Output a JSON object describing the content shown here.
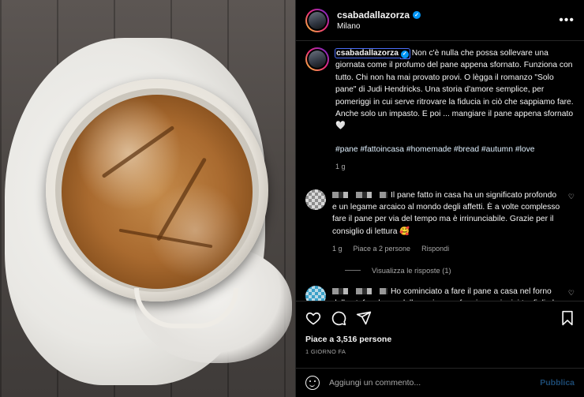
{
  "post": {
    "username": "csabadallazorza",
    "location": "Milano",
    "more_icon": "ellipsis-icon"
  },
  "caption": {
    "username": "csabadallazorza",
    "text": "Non c'è nulla che possa sollevare una giornata come il profumo del pane appena sfornato. Funziona con tutto. Chi non ha mai provato provi. O lègga il romanzo \"Solo pane\" di Judi Hendricks. Una storia d'amore semplice, per pomeriggi in cui serve ritrovare la fiducia in ciò che sappiamo fare. Anche solo un impasto. E poi ... mangiare il pane appena sfornato 🤍",
    "hashtags": "#pane #fattoincasa #homemade #bread #autumn #love",
    "age": "1 g"
  },
  "comments": [
    {
      "text": "Il pane fatto in casa ha un significato profondo e un legame arcaico al mondo degli affetti. È a volte complesso fare il pane per via del tempo ma è irrinunciabile. Grazie per il consiglio di lettura 🥰",
      "age": "1 g",
      "likes": "Piace a 2 persone",
      "reply": "Rispondi",
      "view_replies": "Visualizza le risposte (1)"
    },
    {
      "text": "Ho cominciato a fare il pane a casa nel forno della stufa a legna della cucina per far giocare i miei tre figli...ho proseguito con un elettrodomestico perché il tempo è sempre pochissimo per le mamme che lavorano"
    }
  ],
  "actions": {
    "like_icon": "heart-icon",
    "comment_icon": "comment-icon",
    "share_icon": "share-icon",
    "save_icon": "bookmark-icon"
  },
  "likes_text": "Piace a 3,516 persone",
  "time_ago": "1 GIORNO FA",
  "comment_box": {
    "placeholder": "Aggiungi un commento...",
    "post_label": "Pubblica"
  },
  "colors": {
    "background": "#000000",
    "text": "#f5f5f5",
    "secondary_text": "#a8a8a8",
    "verified": "#0095f6",
    "hashtag": "#e0f1ff",
    "post_disabled": "#1c4a73"
  }
}
